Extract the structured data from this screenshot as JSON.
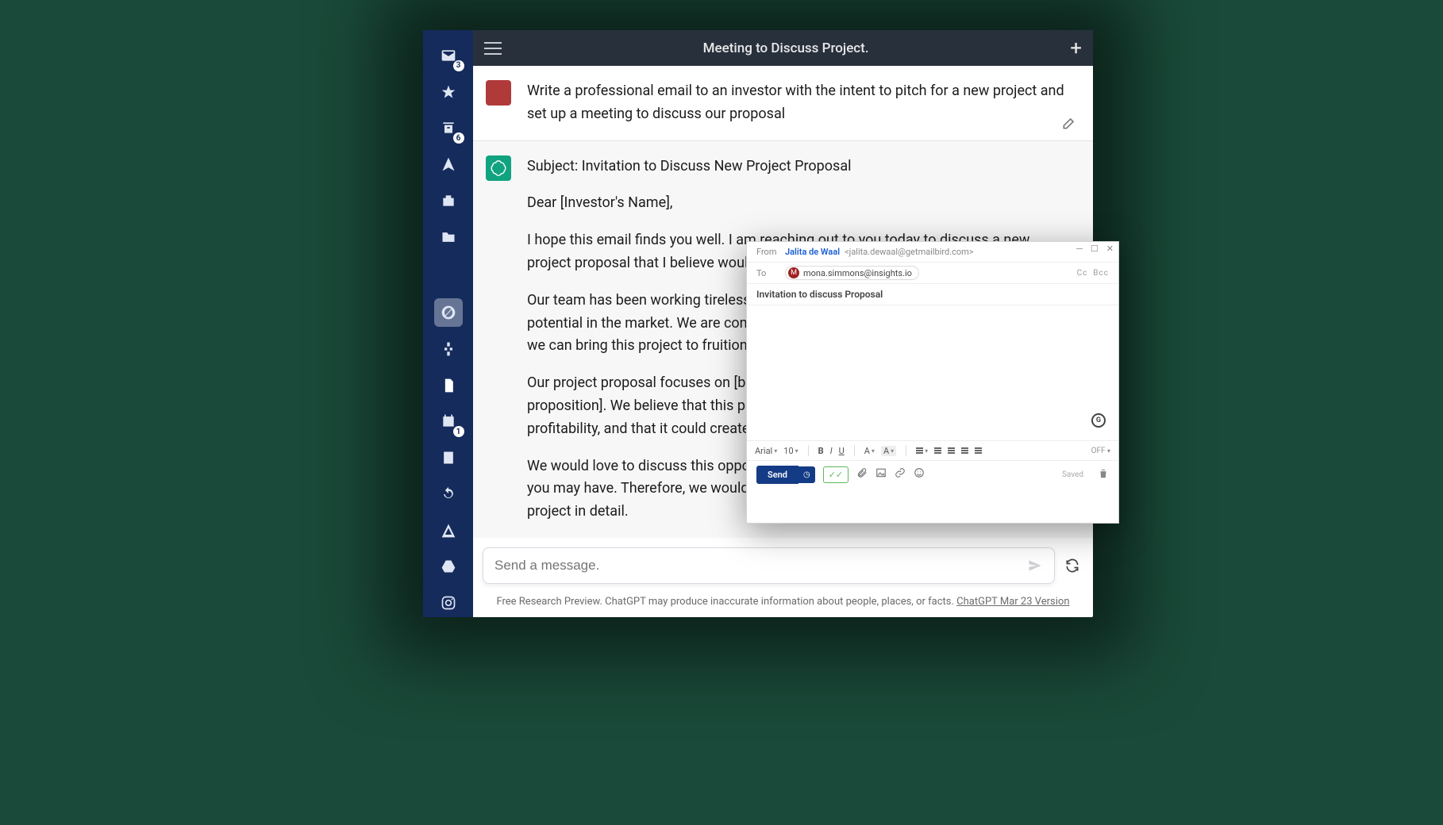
{
  "sidebar": {
    "inbox_badge": "3",
    "archive_badge": "6",
    "calendar_badge": "1"
  },
  "header": {
    "title": "Meeting to Discuss Project."
  },
  "chat": {
    "user_prompt": "Write a professional email to an investor with the intent to pitch for a new project and set up a meeting to discuss our proposal",
    "response": {
      "subject_line": "Subject: Invitation to Discuss New Project Proposal",
      "greeting": "Dear [Investor's Name],",
      "p1": "I hope this email finds you well. I am reaching out to you today to discuss a new project proposal that I believe would be of great interest to you.",
      "p2": "Our team has been working tirelessly on a new project that we believe has tremendous potential in the market. We are confident that with the right investment and support, we can bring this project to fruition and make a significant impact.",
      "p3": "Our project proposal focuses on [briefly describe the project and its unique value proposition]. We believe that this project has a strong potential for growth and profitability, and that it could create a sustainable business model.",
      "p4": "We would love to discuss this opportunity with you further and answer any questions you may have. Therefore, we would like to invite you to a meeting to discuss our project in detail."
    },
    "input_placeholder": "Send a message.",
    "footer_text": "Free Research Preview. ChatGPT may produce inaccurate information about people, places, or facts. ",
    "footer_version": "ChatGPT Mar 23 Version"
  },
  "compose": {
    "from_label": "From",
    "from_name": "Jalita de Waal",
    "from_email": "<jalita.dewaal@getmailbird.com>",
    "to_label": "To",
    "to_initial": "M",
    "to_email": "mona.simmons@insights.io",
    "cc_label": "Cc",
    "bcc_label": "Bcc",
    "subject": "Invitation to discuss Proposal",
    "font_name": "Arial",
    "font_size": "10",
    "bold": "B",
    "italic": "I",
    "underline": "U",
    "text_a": "A",
    "bg_a": "A",
    "off_label": "OFF",
    "send_label": "Send",
    "tracked_label": "✓✓",
    "saved_label": "Saved"
  }
}
